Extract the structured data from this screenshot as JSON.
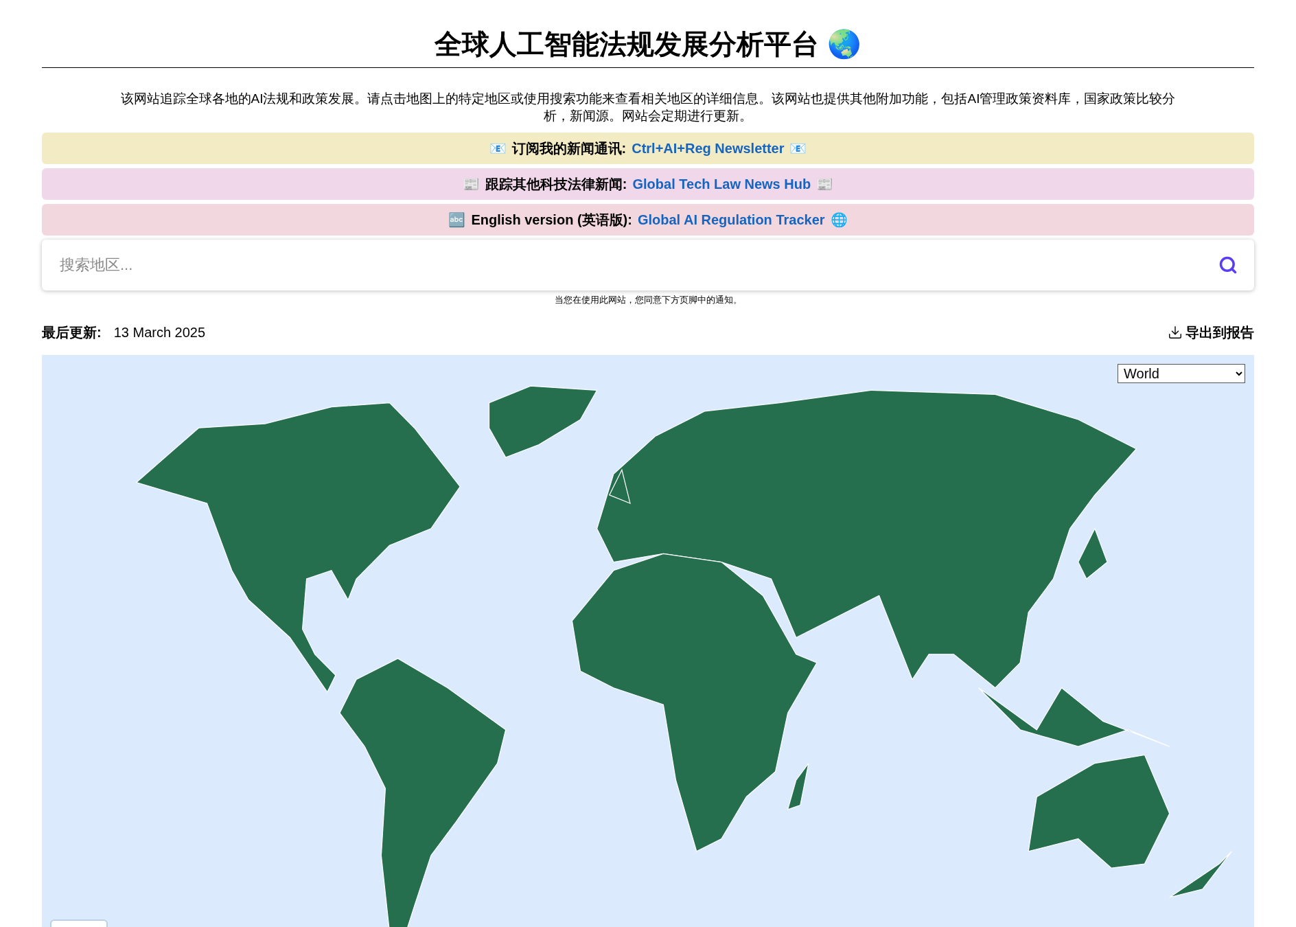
{
  "header": {
    "title": "全球人工智能法规发展分析平台",
    "emoji": "🌏"
  },
  "intro": "该网站追踪全球各地的AI法规和政策发展。请点击地图上的特定地区或使用搜索功能来查看相关地区的详细信息。该网站也提供其他附加功能，包括AI管理政策资料库，国家政策比较分析，新闻源。网站会定期进行更新。",
  "banners": [
    {
      "color": "#f3ebc3",
      "lead": "📧",
      "label": "订阅我的新闻通讯:",
      "link": "Ctrl+AI+Reg Newsletter",
      "trail": "📧"
    },
    {
      "color": "#f1d7ea",
      "lead": "📰",
      "label": "跟踪其他科技法律新闻:",
      "link": "Global Tech Law News Hub",
      "trail": "📰"
    },
    {
      "color": "#f3d7de",
      "lead": "🔤",
      "label": "English version (英语版):",
      "link": "Global AI Regulation Tracker",
      "trail": "🌐"
    }
  ],
  "search": {
    "placeholder": "搜索地区..."
  },
  "notice": "当您在使用此网站，您同意下方页脚中的通知。",
  "updated": {
    "label": "最后更新:",
    "date": "13 March 2025"
  },
  "export": "导出到报告",
  "map": {
    "region": "World"
  }
}
